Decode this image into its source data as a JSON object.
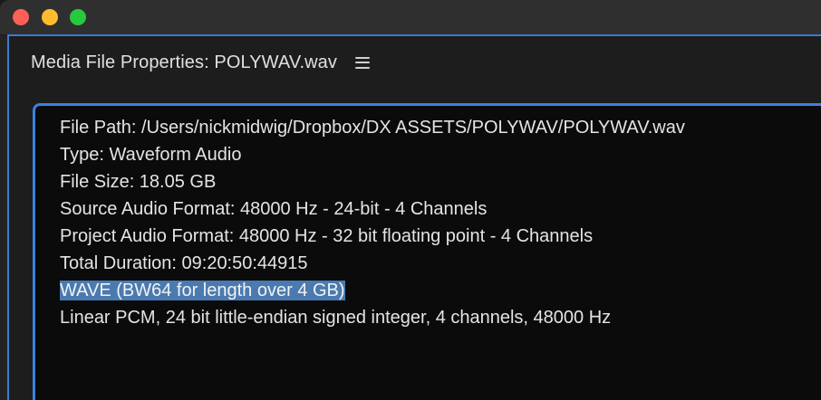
{
  "window": {
    "traffic_lights": {
      "close_color": "#fe5f57",
      "minimize_color": "#febc2e",
      "maximize_color": "#28c840"
    }
  },
  "panel": {
    "title": "Media File Properties: POLYWAV.wav",
    "menu_icon": "hamburger-menu-icon",
    "accent_color": "#3a82e0"
  },
  "properties": {
    "file_path": "File Path: /Users/nickmidwig/Dropbox/DX ASSETS/POLYWAV/POLYWAV.wav",
    "type": "Type: Waveform Audio",
    "file_size": "File Size: 18.05 GB",
    "source_audio_format": "Source Audio Format: 48000 Hz - 24-bit - 4 Channels",
    "project_audio_format": "Project Audio Format: 48000 Hz - 32 bit floating point - 4 Channels",
    "total_duration": "Total Duration: 09:20:50:44915",
    "container": "WAVE (BW64 for length over 4 GB)",
    "codec": "Linear PCM, 24 bit little-endian signed integer, 4 channels, 48000 Hz"
  },
  "selection": {
    "highlight_color": "#4a7ab0"
  }
}
